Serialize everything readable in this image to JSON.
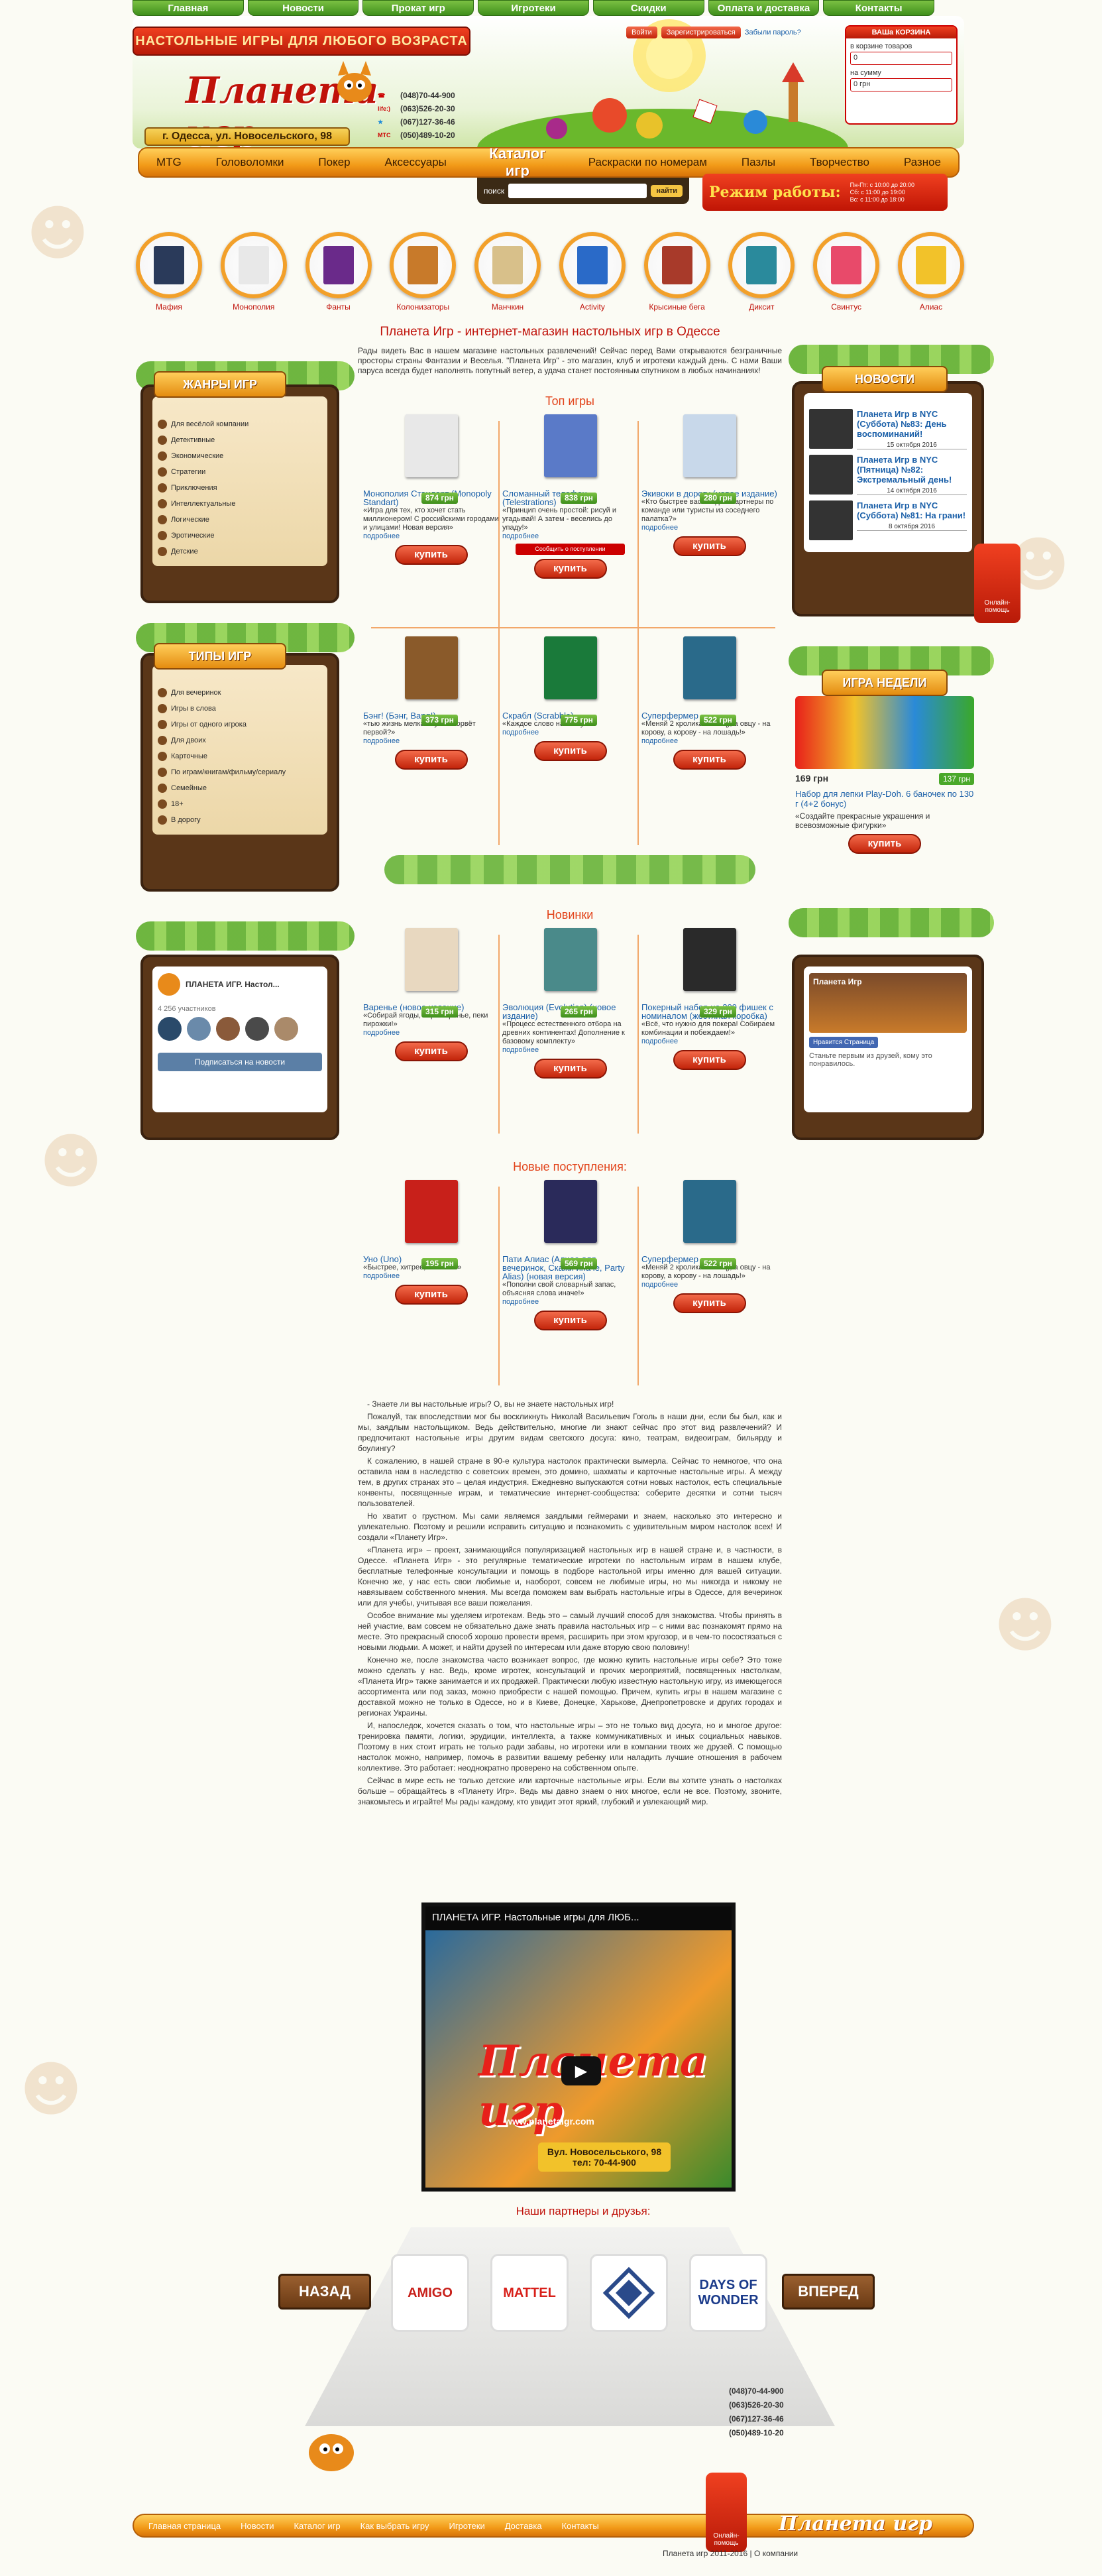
{
  "topmenu": [
    "Главная",
    "Новости",
    "Прокат игр",
    "Игротеки",
    "Скидки",
    "Оплата и доставка",
    "Контакты"
  ],
  "header": {
    "slogan": "НАСТОЛЬНЫЕ ИГРЫ ДЛЯ ЛЮБОГО ВОЗРАСТА",
    "logo": "Планета игр",
    "address": "г. Одесса, ул. Новосельского, 98",
    "phones": [
      {
        "op": "",
        "num": "(048)70-44-900"
      },
      {
        "op": "life:)",
        "num": "(063)526-20-30"
      },
      {
        "op": "",
        "num": "(067)127-36-46"
      },
      {
        "op": "МТС",
        "num": "(050)489-10-20"
      }
    ],
    "login": "Войти",
    "register": "Зарегистрироваться",
    "forgot": "Забыли пароль?"
  },
  "cart": {
    "title": "ВАШа КОРЗИНА",
    "items_label": "в корзине товаров",
    "items_value": "0",
    "sum_label": "на сумму",
    "sum_value": "0 грн"
  },
  "nav": [
    "MTG",
    "Головоломки",
    "Покер",
    "Аксессуары",
    "Каталог игр",
    "Раскраски по номерам",
    "Пазлы",
    "Творчество",
    "Разное"
  ],
  "search": {
    "label": "поиск",
    "button": "найти"
  },
  "hours": {
    "title": "Режим работы:",
    "lines": [
      "Пн-Пт: с 10:00 до 20:00",
      "Сб: с 11:00 до 19:00",
      "Вс: с 11:00 до 18:00"
    ]
  },
  "categories": [
    {
      "name": "Мафия",
      "color": "#2a3a5a"
    },
    {
      "name": "Монополия",
      "color": "#e8e8e8"
    },
    {
      "name": "Фанты",
      "color": "#6a2a8a"
    },
    {
      "name": "Колонизаторы",
      "color": "#c87a2a"
    },
    {
      "name": "Манчкин",
      "color": "#d8c08a"
    },
    {
      "name": "Activity",
      "color": "#2a6ac8"
    },
    {
      "name": "Крысиные бега",
      "color": "#a83a2a"
    },
    {
      "name": "Диксит",
      "color": "#2a8a9c"
    },
    {
      "name": "Свинтус",
      "color": "#e84a6a"
    },
    {
      "name": "Алиас",
      "color": "#f2c22a"
    }
  ],
  "main": {
    "title": "Планета Игр - интернет-магазин настольных игр в Одессе",
    "intro": "Рады видеть Вас в нашем магазине настольных развлечений! Сейчас перед Вами открываются безграничные просторы страны Фантазии и Веселья. \"Планета Игр\" - это магазин, клуб и игротеки каждый день. С нами Ваши паруса всегда будет наполнять попутный ветер, а удача станет постоянным спутником в любых начинаниях!"
  },
  "genres": {
    "title": "ЖАНРЫ ИГР",
    "items": [
      "Для весёлой компании",
      "Детективные",
      "Экономические",
      "Стратегии",
      "Приключения",
      "Интеллектуальные",
      "Логические",
      "Эротические",
      "Детские"
    ]
  },
  "types": {
    "title": "ТИПЫ ИГР",
    "items": [
      "Для вечеринок",
      "Игры в слова",
      "Игры от одного игрока",
      "Для двоих",
      "Карточные",
      "По играм/книгам/фильму/сериалу",
      "Семейные",
      "18+",
      "В дорогу"
    ]
  },
  "vk": {
    "name": "ПЛАНЕТА ИГР. Настол...",
    "members": "4 256 участников",
    "subscribe": "Подписаться на новости"
  },
  "news": {
    "title": "НОВОСТИ",
    "items": [
      {
        "title": "Планета Игр в NYC (Суббота) №83: День воспоминаний!",
        "date": "15 октября 2016"
      },
      {
        "title": "Планета Игр в NYC (Пятница) №82: Экстремальный день!",
        "date": "14 октября 2016"
      },
      {
        "title": "Планета Игр в NYC (Суббота) №81: На грани!",
        "date": "8 октября 2016"
      }
    ]
  },
  "week": {
    "title": "ИГРА НЕДЕЛИ",
    "price": "169 грн",
    "old": "137 грн",
    "name": "Набор для лепки Play-Doh. 6 баночек по 130 г (4+2 бонус)",
    "desc": "«Создайте прекрасные украшения и всевозможные фигурки»"
  },
  "fb": {
    "name": "Планета Игр",
    "likes": "Нравится Страница",
    "text": "Станьте первым из друзей, кому это понравилось."
  },
  "online": "Онлайн-помощь",
  "top_title": "Топ игры",
  "top": [
    {
      "name": "Монополия Стандарт (Monopoly Standart)",
      "price": "874 грн",
      "desc": "«Игра для тех, кто хочет стать миллионером! С российскими городами и улицами! Новая версия»",
      "more": "подробнее",
      "buy": "купить",
      "color": "#e8e8e8"
    },
    {
      "name": "Сломанный телефон (Telestrations)",
      "price": "838 грн",
      "desc": "«Принцип очень простой: рисуй и угадывай! А затем - веселись до упаду!»",
      "more": "подробнее",
      "buy": "купить",
      "color": "#5a7ac8",
      "hot": "Сообщить о поступлении"
    },
    {
      "name": "Экивоки в дорогу (новое издание)",
      "price": "280 грн",
      "desc": "«Кто быстрее вас пойдёт: партнеры по команде или туристы из соседнего палатка?»",
      "more": "подробнее",
      "buy": "купить",
      "color": "#c8d8ea"
    },
    {
      "name": "Бэнг! (Бэнг, Bang!)",
      "price": "373 грн",
      "desc": "«тью жизнь мелкая пуля оборвёт первой?»",
      "more": "подробнее",
      "buy": "купить",
      "color": "#8a5a2a"
    },
    {
      "name": "Скрабл (Scrabble)",
      "price": "775 грн",
      "desc": "«Каждое слово на счету!»",
      "more": "подробнее",
      "buy": "купить",
      "color": "#1a7a3a"
    },
    {
      "name": "Суперфермер",
      "price": "522 грн",
      "desc": "«Меняй 2 кролика на овцу, а овцу - на корову, а корову - на лошадь!»",
      "more": "подробнее",
      "buy": "купить",
      "color": "#2a6a8a"
    }
  ],
  "new_title": "Новинки",
  "newgames": [
    {
      "name": "Варенье (новое издание)",
      "price": "315 грн",
      "desc": "«Собирай ягоды, вари варенье, пеки пирожки!»",
      "more": "подробнее",
      "buy": "купить",
      "color": "#e8d8c0"
    },
    {
      "name": "Эволюция (Evolution) (новое издание)",
      "price": "265 грн",
      "desc": "«Процесс естественного отбора на древних континентах! Дополнение к базовому комплекту»",
      "more": "подробнее",
      "buy": "купить",
      "color": "#4a8a8a"
    },
    {
      "name": "Покерный набор на 200 фишек с номиналом (жестяная коробка)",
      "price": "329 грн",
      "desc": "«Всё, что нужно для покера! Собираем комбинации и побеждаем!»",
      "more": "подробнее",
      "buy": "купить",
      "color": "#2a2a2a"
    }
  ],
  "arr_title": "Новые поступления:",
  "arrivals": [
    {
      "name": "Уно (Uno)",
      "price": "195 грн",
      "desc": "«Быстрее, хитрее, веселей!»",
      "more": "подробнее",
      "buy": "купить",
      "color": "#c8201a"
    },
    {
      "name": "Пати Алиас (Алиас для вечеринок, Скажи иначе, Party Alias) (новая версия)",
      "price": "569 грн",
      "desc": "«Пополни свой словарный запас, объясняя слова иначе!»",
      "more": "подробнее",
      "buy": "купить",
      "color": "#2a2a5a"
    },
    {
      "name": "Суперфермер",
      "price": "522 грн",
      "desc": "«Меняй 2 кролика на овцу, а овцу - на корову, а корову - на лошадь!»",
      "more": "подробнее",
      "buy": "купить",
      "color": "#2a6a8a"
    }
  ],
  "text": [
    "- Знаете ли вы настольные игры? О, вы не знаете настольных игр!",
    "Пожалуй, так впоследствии мог бы воскликнуть Николай Васильевич Гоголь в наши дни, если бы был, как и мы, заядлым настольщиком. Ведь действительно, многие ли знают сейчас про этот вид развлечений? И предпочитают настольные игры другим видам светского досуга: кино, театрам, видеоиграм, бильярду и боулингу?",
    "К сожалению, в нашей стране в 90-е культура настолок практически вымерла. Сейчас то немногое, что она оставила нам в наследство с советских времен, это домино, шахматы и карточные настольные игры. А между тем, в других странах это – целая индустрия. Ежедневно выпускаются сотни новых настолок, есть специальные конвенты, посвященные играм, и тематические интернет-сообщества: соберите десятки и сотни тысяч пользователей.",
    "Но хватит о грустном. Мы сами являемся заядлыми геймерами и знаем, насколько это интересно и увлекательно. Поэтому и решили исправить ситуацию и познакомить с удивительным миром настолок всех! И создали «Планету Игр».",
    "«Планета игр» – проект, занимающийся популяризацией настольных игр в нашей стране и, в частности, в Одессе. «Планета Игр» - это регулярные тематические игротеки по настольным играм в нашем клубе, бесплатные телефонные консультации и помощь в подборе настольной игры именно для вашей ситуации. Конечно же, у нас есть свои любимые и, наоборот, совсем не любимые игры, но мы никогда и никому не навязываем собственного мнения. Мы всегда поможем вам выбрать настольные игры в Одессе, для вечеринок или для учебы, учитывая все ваши пожелания.",
    "Особое внимание мы уделяем игротекам. Ведь это – самый лучший способ для знакомства. Чтобы принять в ней участие, вам совсем не обязательно даже знать правила настольных игр – с ними вас познакомят прямо на месте. Это прекрасный способ хорошо провести время, расширить при этом кругозор, и в чем-то посостязаться с новыми людьми. А может, и найти друзей по интересам или даже вторую свою половину!",
    "Конечно же, после знакомства часто возникает вопрос, где можно купить настольные игры себе? Это тоже можно сделать у нас. Ведь, кроме игротек, консультаций и прочих мероприятий, посвященных настолкам, «Планета Игр» также занимается и их продажей. Практически любую известную настольную игру, из имеющегося ассортимента или под заказ, можно приобрести с нашей помощью. Причем, купить игры в нашем магазине с доставкой можно не только в Одессе, но и в Киеве, Донецке, Харькове, Днепропетровске и других городах и регионах Украины.",
    "И, напоследок, хочется сказать о том, что настольные игры – это не только вид досуга, но и многое другое: тренировка памяти, логики, эрудиции, интеллекта, а также коммуникативных и иных социальных навыков. Поэтому в них стоит играть не только ради забавы, но игротеки или в компании твоих же друзей. С помощью настолок можно, например, помочь в развитии вашему ребенку или наладить лучшие отношения в рабочем коллективе. Это работает: неоднократно проверено на собственном опыте.",
    "Сейчас в мире есть не только детские или карточные настольные игры. Если вы хотите узнать о настолках больше – обращайтесь в «Планету Игр». Ведь мы давно знаем о них многое, если не все. Поэтому, звоните, знакомьтесь и играйте! Мы рады каждому, кто увидит этот яркий, глубокий и увлекающий мир."
  ],
  "video": {
    "title": "ПЛАНЕТА ИГР. Настольные игры для ЛЮБ...",
    "caption": "Вул. Новосельського, 98 тел: 70-44-900",
    "site": "www.planetaigr.com"
  },
  "partners": {
    "title": "Наши партнеры и друзья:",
    "back": "НАЗАД",
    "fwd": "ВПЕРЕД",
    "logos": [
      {
        "n": "AMIGO",
        "c": "#c8201a"
      },
      {
        "n": "MATTEL",
        "c": "#d8201a"
      },
      {
        "n": "",
        "c": "#2a4a8a"
      },
      {
        "n": "DAYS OF WONDER",
        "c": "#1a3a8a"
      }
    ]
  },
  "footer": {
    "nav": [
      "Главная страница",
      "Новости",
      "Каталог игр",
      "Как выбрать игру",
      "Игротеки",
      "Доставка",
      "Контакты"
    ],
    "copyright": "Планета игр 2011-2016 | О компании",
    "logo": "Планета игр"
  }
}
